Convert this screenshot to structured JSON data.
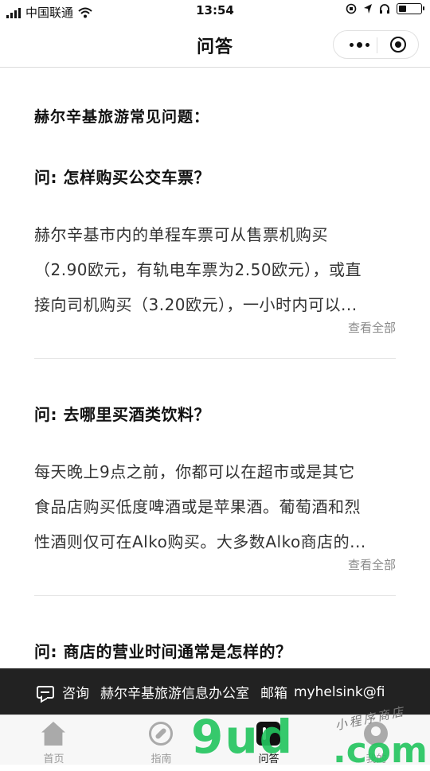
{
  "status_bar": {
    "carrier": "中国联通",
    "time": "13:54",
    "battery_level": 0.35
  },
  "nav": {
    "title": "问答"
  },
  "section_title": "赫尔辛基旅游常见问题：",
  "faq": [
    {
      "question": "问: 怎样购买公交车票？",
      "answer_lines": [
        "赫尔辛基市内的单程车票可从售票机购买",
        "（2.90欧元，有轨电车票为2.50欧元），或直",
        "接向司机购买（3.20欧元），一小时内可以..."
      ],
      "more_label": "查看全部"
    },
    {
      "question": "问: 去哪里买酒类饮料？",
      "answer_lines": [
        "每天晚上9点之前，你都可以在超市或是其它",
        "食品店购买低度啤酒或是苹果酒。葡萄酒和烈",
        "性酒则仅可在Alko购买。大多数Alko商店的..."
      ],
      "more_label": "查看全部"
    },
    {
      "question": "问: 商店的营业时间通常是怎样的？"
    }
  ],
  "contact_bar": {
    "consult_label": "咨询",
    "office_label": "赫尔辛基旅游信息办公室",
    "mail_label": "邮箱",
    "mail_value": "myhelsink@fi"
  },
  "tabs": [
    {
      "label": "首页",
      "icon": "home-icon"
    },
    {
      "label": "指南",
      "icon": "compass-icon"
    },
    {
      "label": "问答",
      "icon": "qa-icon"
    },
    {
      "label": "我的",
      "icon": "profile-icon"
    }
  ],
  "watermark": {
    "site": "9ud",
    "tld": ".com",
    "tagline": "小程序商店"
  }
}
